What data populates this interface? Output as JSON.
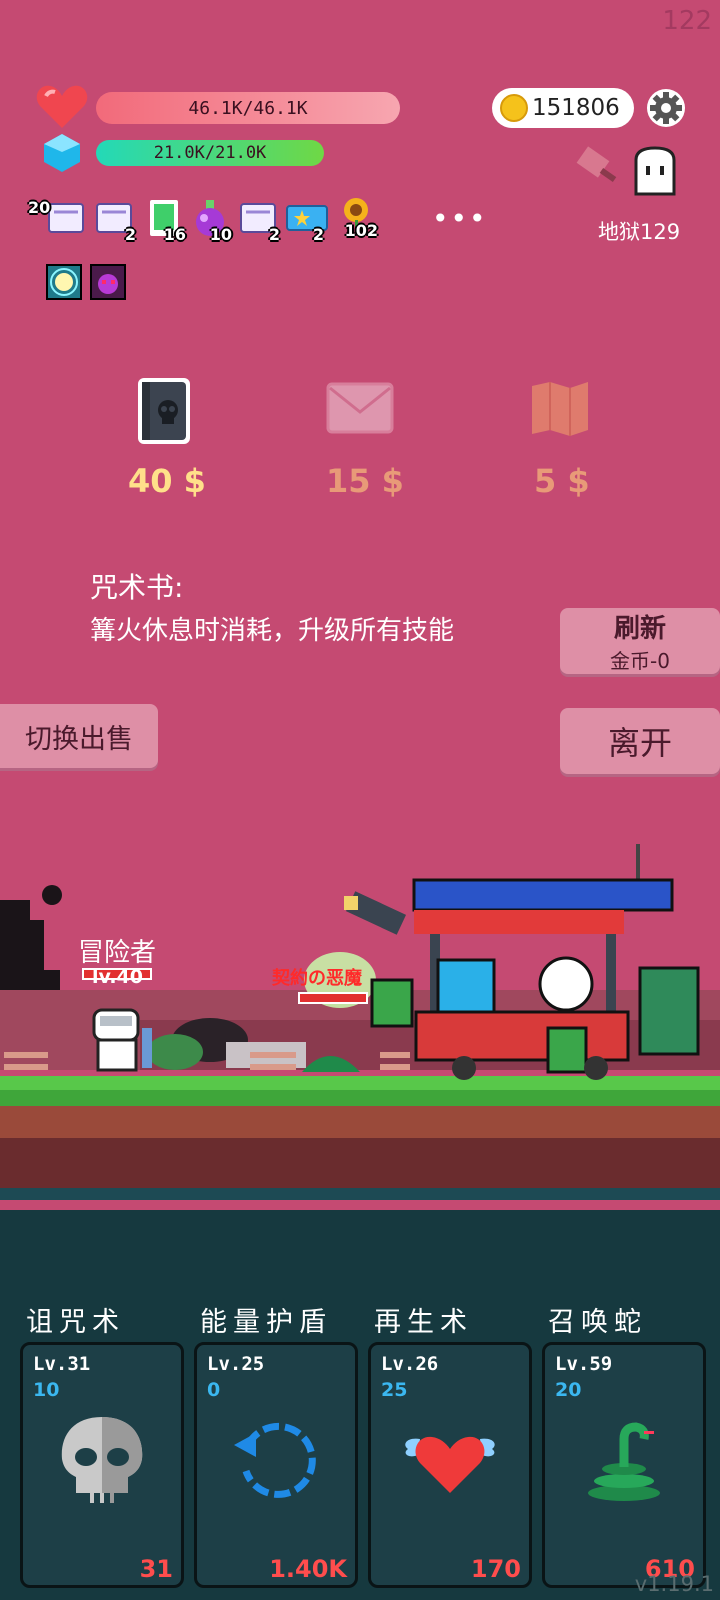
{
  "fps": "122",
  "status": {
    "hp": "46.1K/46.1K",
    "mp": "21.0K/21.0K",
    "coins": "151806",
    "location": "地狱129"
  },
  "items": [
    {
      "icon": "scroll-icon",
      "count": "20"
    },
    {
      "icon": "scroll-icon",
      "count": "2"
    },
    {
      "icon": "green-card-icon",
      "count": "16"
    },
    {
      "icon": "potion-icon",
      "count": "10"
    },
    {
      "icon": "scroll-icon",
      "count": "2"
    },
    {
      "icon": "star-ticket-icon",
      "count": "2"
    },
    {
      "icon": "sunflower-icon",
      "count": "102"
    }
  ],
  "more": "•••",
  "shop": {
    "prices": [
      "40 $",
      "15 $",
      "5 $"
    ],
    "price_colors": [
      "#ffe08a",
      "#e89a78",
      "#e89a78"
    ],
    "desc_title": "咒术书:",
    "desc_text": "篝火休息时消耗，升级所有技能",
    "refresh_label": "刷新",
    "refresh_cost": "金币-0",
    "leave_label": "离开",
    "switch_label": "切换出售"
  },
  "scene": {
    "adventurer_name": "冒险者",
    "adventurer_level": "lv.40",
    "red_text": "契約の恶魔"
  },
  "skills": [
    {
      "name": "诅咒术",
      "level": "Lv.31",
      "cost": "10",
      "value": "31",
      "icon": "skull-icon"
    },
    {
      "name": "能量护盾",
      "level": "Lv.25",
      "cost": "0",
      "value": "1.40K",
      "icon": "refresh-ring-icon"
    },
    {
      "name": "再生术",
      "level": "Lv.26",
      "cost": "25",
      "value": "170",
      "icon": "winged-heart-icon"
    },
    {
      "name": "召唤蛇",
      "level": "Lv.59",
      "cost": "20",
      "value": "610",
      "icon": "snake-icon"
    }
  ],
  "version": "v1.19.1"
}
